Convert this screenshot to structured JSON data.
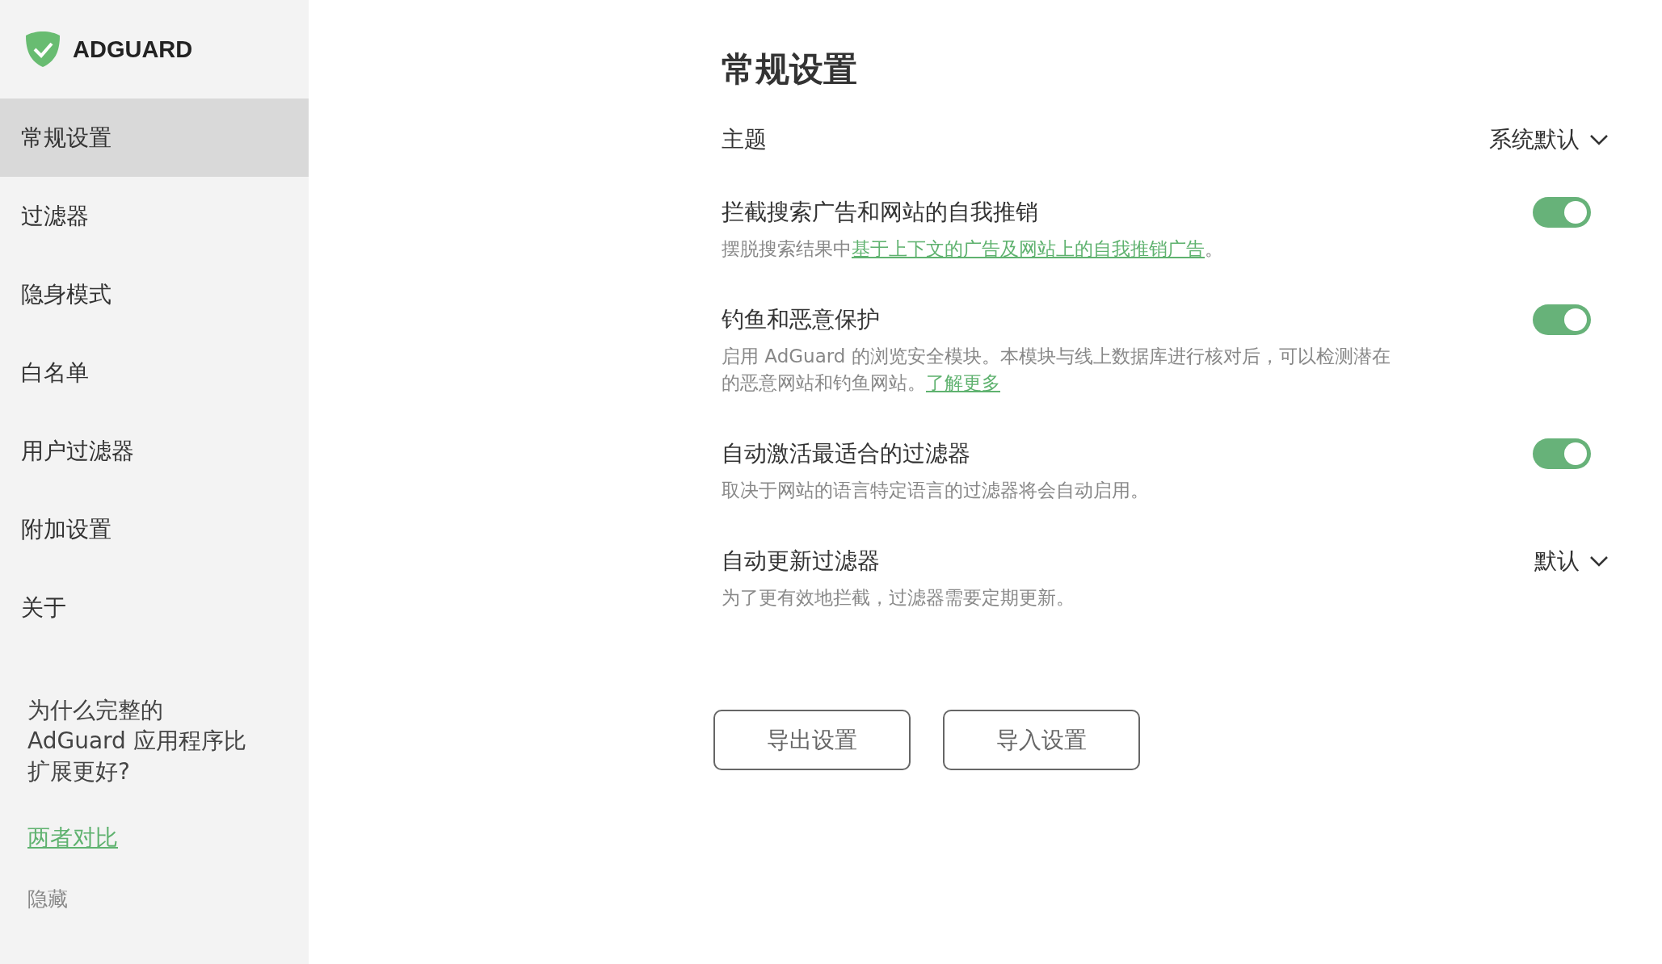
{
  "brand": {
    "name": "ADGUARD"
  },
  "sidebar": {
    "items": [
      {
        "label": "常规设置",
        "selected": true
      },
      {
        "label": "过滤器",
        "selected": false
      },
      {
        "label": "隐身模式",
        "selected": false
      },
      {
        "label": "白名单",
        "selected": false
      },
      {
        "label": "用户过滤器",
        "selected": false
      },
      {
        "label": "附加设置",
        "selected": false
      },
      {
        "label": "关于",
        "selected": false
      }
    ],
    "promo": {
      "lines": [
        "为什么完整的",
        "AdGuard 应用程序比",
        "扩展更好?"
      ],
      "link": "两者对比",
      "hide": "隐藏"
    }
  },
  "page": {
    "title": "常规设置",
    "settings": [
      {
        "kind": "dropdown",
        "title": "主题",
        "value": "系统默认"
      },
      {
        "kind": "toggle",
        "title": "拦截搜索广告和网站的自我推销",
        "description": "摆脱搜索结果中",
        "link": "基于上下文的广告及网站上的自我推销广告",
        "after": "。",
        "checked": true
      },
      {
        "kind": "toggle",
        "title": "钓鱼和恶意保护",
        "description": "启用 AdGuard 的浏览安全模块。本模块与线上数据库进行核对后，可以检测潜在的恶意网站和钓鱼网站。",
        "link": "了解更多",
        "checked": true
      },
      {
        "kind": "toggle",
        "title": "自动激活最适合的过滤器",
        "description": "取决于网站的语言特定语言的过滤器将会自动启用。",
        "checked": true
      },
      {
        "kind": "dropdown",
        "title": "自动更新过滤器",
        "description": "为了更有效地拦截，过滤器需要定期更新。",
        "value": "默认"
      }
    ],
    "buttons": [
      "导出设置",
      "导入设置"
    ]
  }
}
